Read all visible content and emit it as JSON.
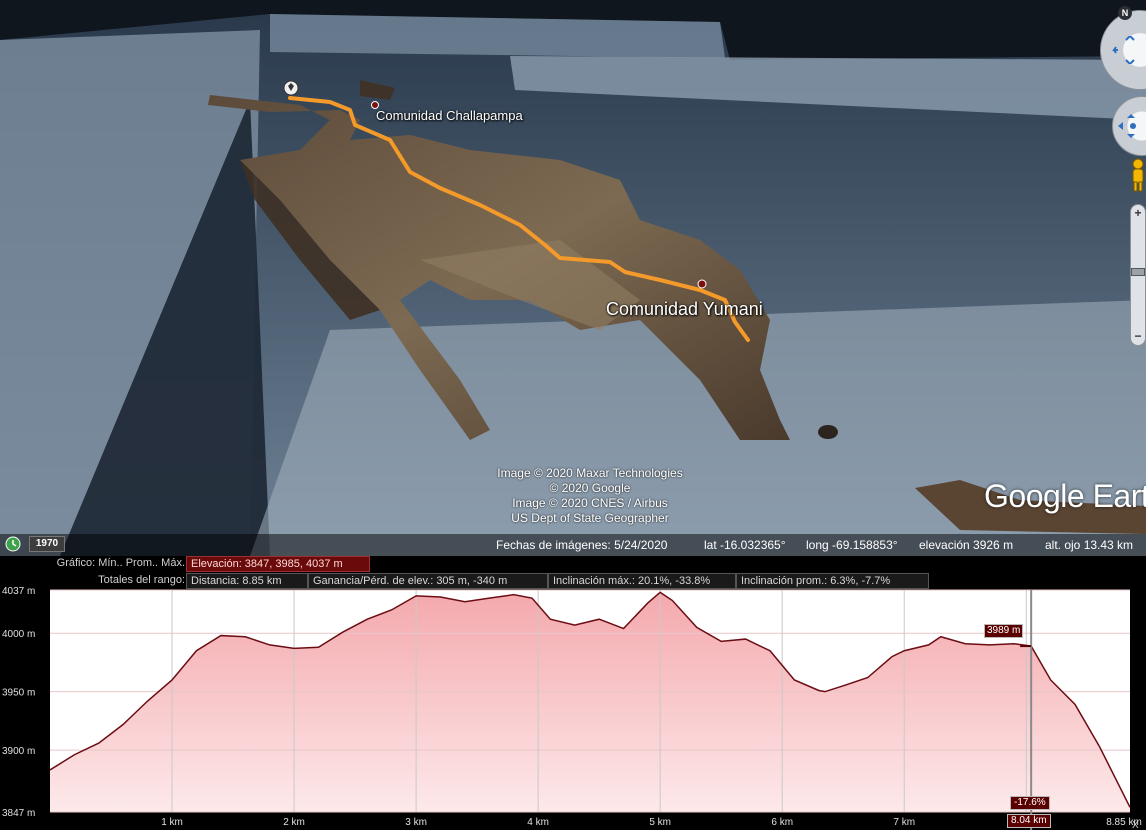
{
  "map": {
    "labels": {
      "challapampa": "Comunidad Challapampa",
      "yumani": "Comunidad Yumani"
    },
    "credits": [
      "Image © 2020 Maxar Technologies",
      "© 2020 Google",
      "Image © 2020 CNES / Airbus",
      "US Dept of State Geographer"
    ],
    "logo": "Google Earth",
    "year_badge": "1970",
    "status": {
      "imagery_date": "Fechas de imágenes: 5/24/2020",
      "lat": "lat  -16.032365°",
      "long": "long  -69.158853°",
      "elevation": "elevación  3926 m",
      "eye_alt": "alt. ojo  13.43 km"
    },
    "north": "N",
    "colors": {
      "route": "#f39a2b",
      "profile_fill": "#f6c2c4",
      "profile_line": "#6b0d13"
    }
  },
  "profile": {
    "graph_label": "Gráfico: Mín.. Prom.. Máx.",
    "elevation_stat": "Elevación: 3847, 3985, 4037 m",
    "totals_label": "Totales del rango:",
    "distance": "Distancia: 8.85 km",
    "gain_loss": "Ganancia/Pérd. de elev.: 305 m, -340 m",
    "max_slope": "Inclinación máx.: 20.1%, -33.8%",
    "avg_slope": "Inclinación prom.: 6.3%, -7.7%",
    "marker_elev": "3989 m",
    "marker_slope": "-17.6%",
    "marker_dist": "8.04 km",
    "close": "X"
  },
  "chart_data": {
    "type": "area",
    "title": "",
    "xlabel": "",
    "ylabel": "",
    "xlim": [
      0,
      8.85
    ],
    "ylim": [
      3847,
      4037
    ],
    "ytick_labels": [
      "4037 m",
      "4000 m",
      "3950 m",
      "3900 m",
      "3847 m"
    ],
    "yticks": [
      4037,
      4000,
      3950,
      3900,
      3847
    ],
    "xtick_labels": [
      "1 km",
      "2 km",
      "3 km",
      "4 km",
      "5 km",
      "6 km",
      "7 km",
      "8 km",
      "8.85 km"
    ],
    "xticks": [
      1,
      2,
      3,
      4,
      5,
      6,
      7,
      8
    ],
    "x": [
      0,
      0.2,
      0.4,
      0.6,
      0.8,
      1.0,
      1.2,
      1.4,
      1.6,
      1.8,
      2.0,
      2.2,
      2.4,
      2.6,
      2.8,
      3.0,
      3.2,
      3.4,
      3.6,
      3.8,
      3.95,
      4.1,
      4.3,
      4.5,
      4.7,
      4.9,
      5.0,
      5.1,
      5.3,
      5.5,
      5.7,
      5.9,
      6.1,
      6.3,
      6.35,
      6.5,
      6.7,
      6.9,
      7.0,
      7.2,
      7.3,
      7.5,
      7.7,
      7.9,
      8.04,
      8.2,
      8.4,
      8.6,
      8.85
    ],
    "series": [
      {
        "values": [
          3883,
          3896,
          3906,
          3922,
          3942,
          3960,
          3985,
          3998,
          3997,
          3990,
          3987,
          3988,
          4001,
          4012,
          4020,
          4032,
          4031,
          4027,
          4030,
          4033,
          4030,
          4012,
          4007,
          4012,
          4004,
          4026,
          4035,
          4028,
          4005,
          3993,
          3995,
          3985,
          3960,
          3951,
          3950,
          3955,
          3962,
          3980,
          3985,
          3990,
          3997,
          3991,
          3990,
          3991,
          3989,
          3960,
          3939,
          3903,
          3851
        ]
      }
    ],
    "marker": {
      "x": 8.04,
      "elevation": 3989,
      "slope": "-17.6%"
    },
    "grid": true,
    "legend": "none"
  }
}
